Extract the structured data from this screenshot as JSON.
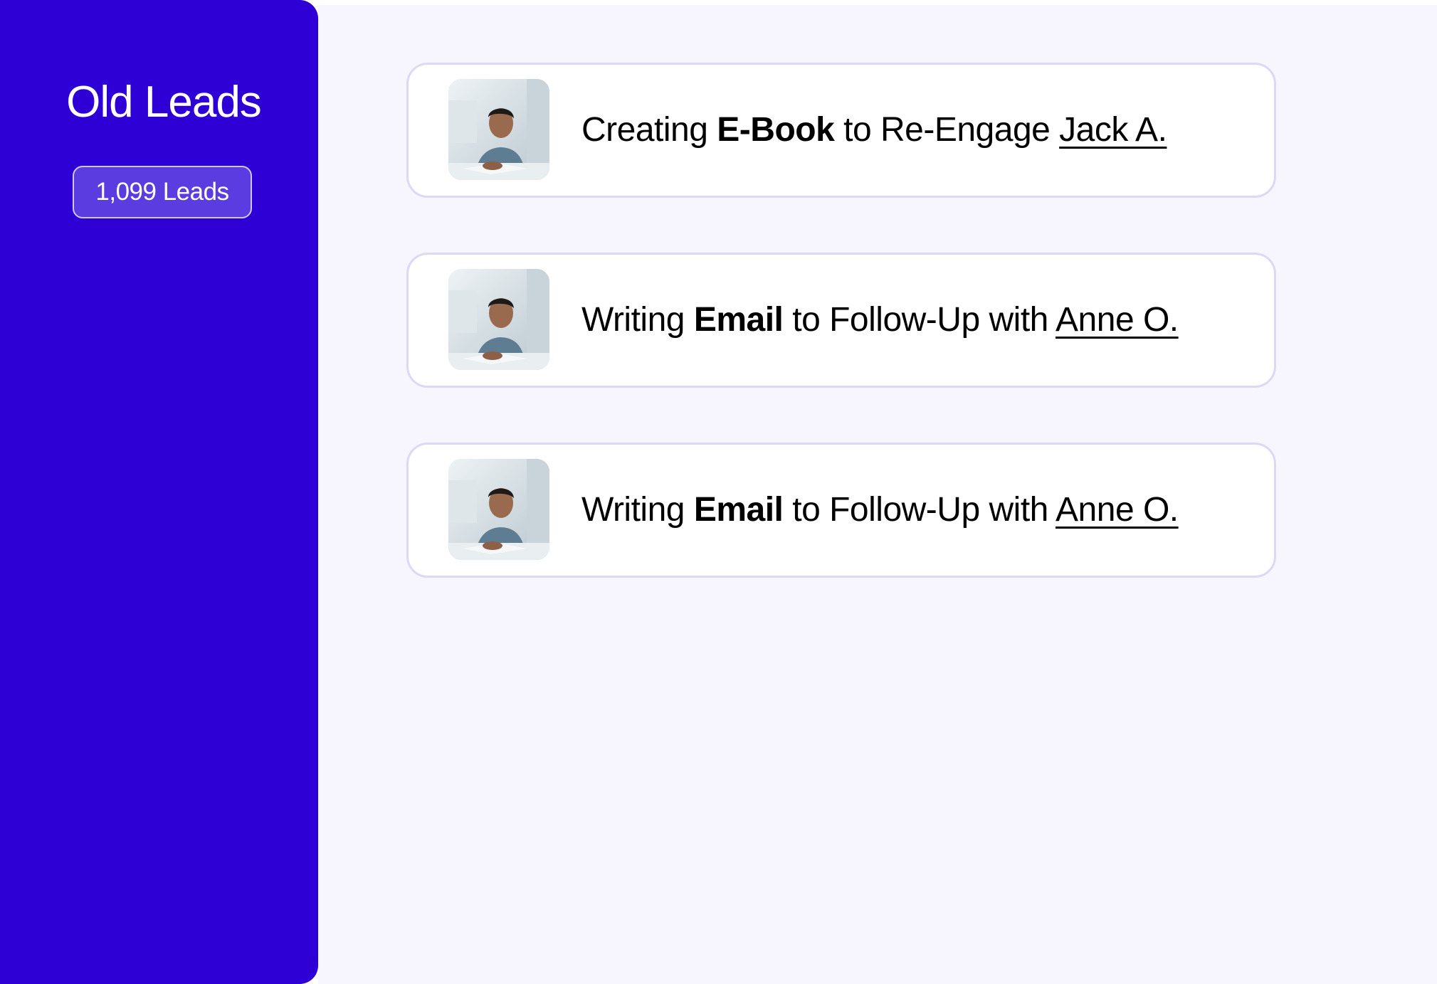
{
  "sidebar": {
    "title": "Old Leads",
    "count_badge": "1,099 Leads"
  },
  "colors": {
    "sidebar_bg": "#2e00d6",
    "badge_bg": "#5a3ce0",
    "main_bg": "#f7f6ff",
    "card_border": "#dcd8f5"
  },
  "tasks": [
    {
      "avatar_icon": "person-photo",
      "verb": "Creating",
      "asset": "E-Book",
      "purpose": "to Re-Engage",
      "lead_name": "Jack A."
    },
    {
      "avatar_icon": "person-photo",
      "verb": "Writing",
      "asset": "Email",
      "purpose": "to Follow-Up with",
      "lead_name": "Anne O."
    },
    {
      "avatar_icon": "person-photo",
      "verb": "Writing",
      "asset": "Email",
      "purpose": "to Follow-Up with",
      "lead_name": "Anne O."
    }
  ]
}
